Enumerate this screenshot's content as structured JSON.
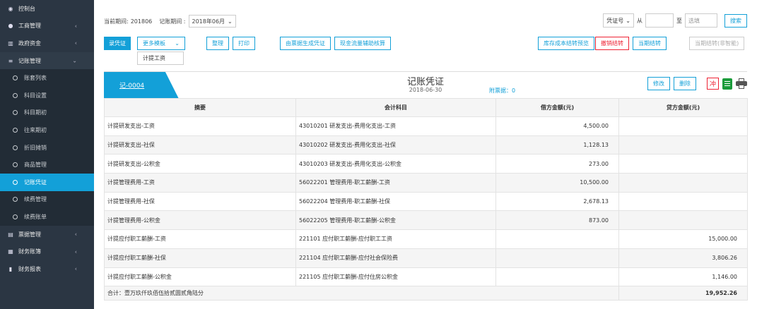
{
  "sidebar": {
    "items": [
      {
        "label": "控制台",
        "icon": "dashboard-icon"
      },
      {
        "label": "工商管理",
        "icon": "circle-p-icon"
      },
      {
        "label": "政府资金",
        "icon": "bank-icon"
      },
      {
        "label": "记账管理",
        "icon": "list-icon"
      },
      {
        "label": "票据管理",
        "icon": "card-icon"
      },
      {
        "label": "财务账簿",
        "icon": "grid-icon"
      },
      {
        "label": "财务报表",
        "icon": "bar-chart-icon"
      }
    ],
    "sub_items": [
      "账套列表",
      "科目设置",
      "科目期初",
      "往来期初",
      "折旧摊销",
      "商品管理",
      "记账凭证",
      "续费管理",
      "续费账单"
    ],
    "active_sub": "记账凭证"
  },
  "filter": {
    "current_period_label": "当前期间:",
    "current_period_value": "201806",
    "accounting_period_label": "记账期间 :",
    "accounting_period_value": "2018年06月"
  },
  "search": {
    "field_select": "凭证号",
    "from_label": "从",
    "to_label": "至",
    "placeholder": "选填",
    "search_button": "搜索"
  },
  "toolbar": {
    "record_voucher": "录凭证",
    "more_templates": "更多模板",
    "organize": "整理",
    "print": "打印",
    "generate_from_bills": "由票据生成凭证",
    "cash_flow_assist": "现金流量辅助核算",
    "inventory_cost_preview": "库存成本结转预览",
    "cancel_carryover": "撤销结转",
    "period_carryover": "当期结转",
    "period_carryover_non_smart": "当期结转(非智能)"
  },
  "dropdown": {
    "item": "计提工资"
  },
  "voucher": {
    "number": "记-0004",
    "title": "记账凭证",
    "date": "2018-06-30",
    "attachments": "附票据：0",
    "edit": "修改",
    "delete": "删除",
    "reverse": "冲"
  },
  "table": {
    "headers": [
      "摘要",
      "会计科目",
      "借方金额(元)",
      "贷方金额(元)"
    ],
    "rows": [
      [
        "计提研发支出-工资",
        "43010201 研发支出-费用化支出-工资",
        "4,500.00",
        ""
      ],
      [
        "计提研发支出-社保",
        "43010202 研发支出-费用化支出-社保",
        "1,128.13",
        ""
      ],
      [
        "计提研发支出-公积金",
        "43010203 研发支出-费用化支出-公积金",
        "273.00",
        ""
      ],
      [
        "计提管理费用-工资",
        "56022201 管理费用-职工薪酬-工资",
        "10,500.00",
        ""
      ],
      [
        "计提管理费用-社保",
        "56022204 管理费用-职工薪酬-社保",
        "2,678.13",
        ""
      ],
      [
        "计提管理费用-公积金",
        "56022205 管理费用-职工薪酬-公积金",
        "873.00",
        ""
      ],
      [
        "计提应付职工薪酬-工资",
        "221101 应付职工薪酬-应付职工工资",
        "",
        "15,000.00"
      ],
      [
        "计提应付职工薪酬-社保",
        "221104 应付职工薪酬-应付社会保险费",
        "",
        "3,806.26"
      ],
      [
        "计提应付职工薪酬-公积金",
        "221105 应付职工薪酬-应付住房公积金",
        "",
        "1,146.00"
      ]
    ],
    "total_label": "合计：壹万玖仟玖佰伍拾贰圆贰角陆分",
    "total_credit": "19,952.26"
  },
  "colors": {
    "accent": "#13a0d8",
    "sidebar_bg": "#2b3643",
    "danger": "#ee2233",
    "excel_green": "#1a9b3a"
  }
}
